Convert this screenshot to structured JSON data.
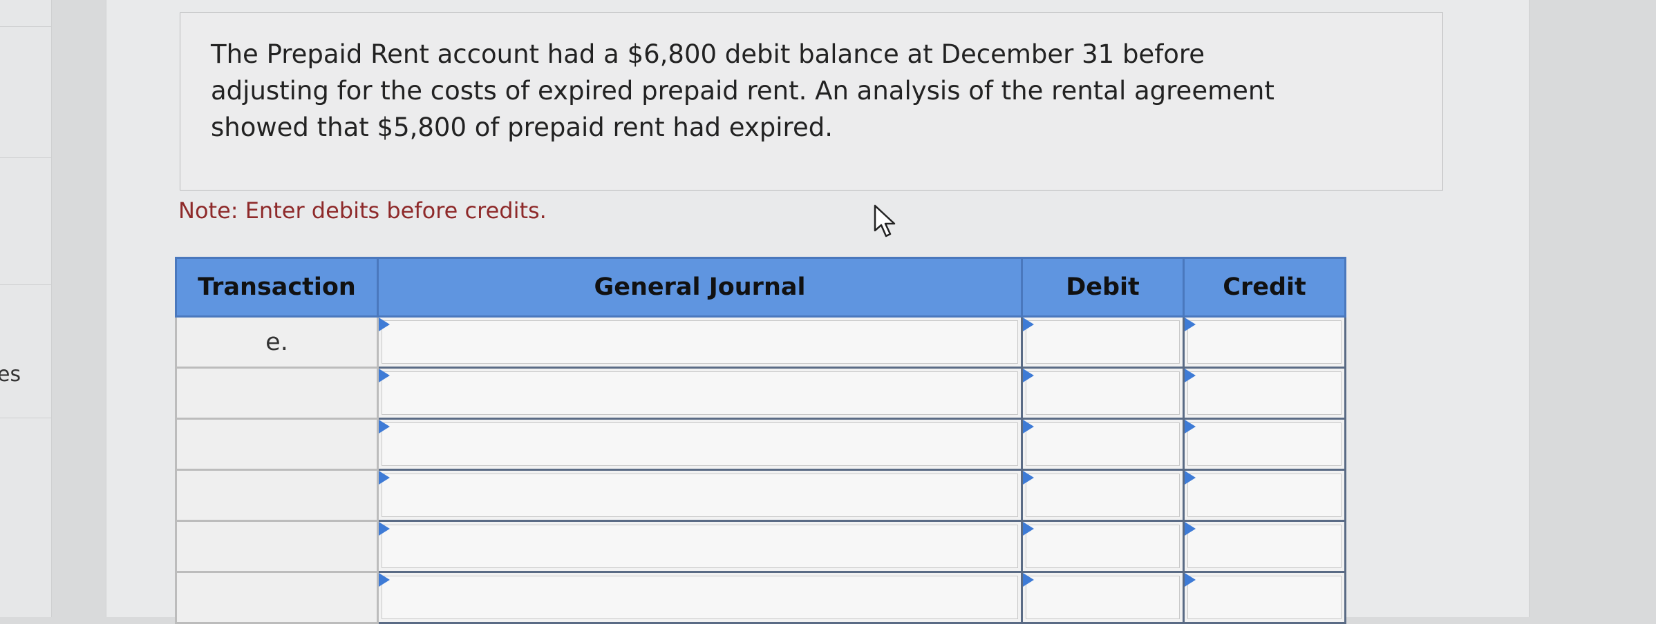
{
  "sidebar": {
    "partial_text": "es"
  },
  "question": {
    "text": "The Prepaid Rent account had a $6,800 debit balance at December 31 before adjusting for the costs of expired prepaid rent. An analysis of the rental agreement showed that $5,800 of prepaid rent had expired."
  },
  "note": "Note: Enter debits before credits.",
  "table": {
    "headers": {
      "transaction": "Transaction",
      "general_journal": "General Journal",
      "debit": "Debit",
      "credit": "Credit"
    },
    "rows": [
      {
        "transaction": "e.",
        "general_journal": "",
        "debit": "",
        "credit": ""
      },
      {
        "transaction": "",
        "general_journal": "",
        "debit": "",
        "credit": ""
      },
      {
        "transaction": "",
        "general_journal": "",
        "debit": "",
        "credit": ""
      },
      {
        "transaction": "",
        "general_journal": "",
        "debit": "",
        "credit": ""
      },
      {
        "transaction": "",
        "general_journal": "",
        "debit": "",
        "credit": ""
      },
      {
        "transaction": "",
        "general_journal": "",
        "debit": "",
        "credit": ""
      }
    ]
  },
  "icons": {
    "cursor": "mouse-pointer-icon",
    "dropdown": "triangle-dropdown-icon"
  },
  "colors": {
    "header_blue": "#5f95e0",
    "note_red": "#8e2a2a"
  }
}
